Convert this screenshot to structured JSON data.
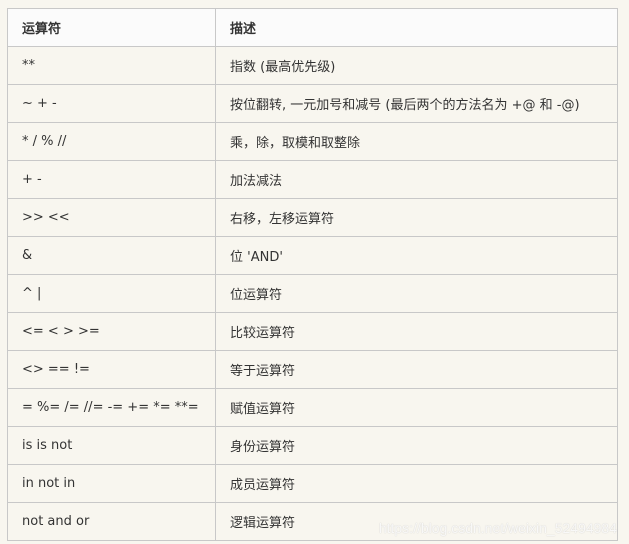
{
  "table": {
    "headers": [
      "运算符",
      "描述"
    ],
    "rows": [
      [
        "**",
        "指数 (最高优先级)"
      ],
      [
        "~ + -",
        "按位翻转, 一元加号和减号 (最后两个的方法名为 +@ 和 -@)"
      ],
      [
        "* / % //",
        "乘，除，取模和取整除"
      ],
      [
        "+ -",
        "加法减法"
      ],
      [
        ">> <<",
        "右移，左移运算符"
      ],
      [
        "&",
        "位 'AND'"
      ],
      [
        "^ |",
        "位运算符"
      ],
      [
        "<= < > >=",
        "比较运算符"
      ],
      [
        "<> == !=",
        "等于运算符"
      ],
      [
        "= %= /= //= -= += *= **=",
        "赋值运算符"
      ],
      [
        "is is not",
        "身份运算符"
      ],
      [
        "in not in",
        "成员运算符"
      ],
      [
        "not and or",
        "逻辑运算符"
      ]
    ]
  },
  "watermark": "https://blog.csdn.net/weixin_52494984"
}
